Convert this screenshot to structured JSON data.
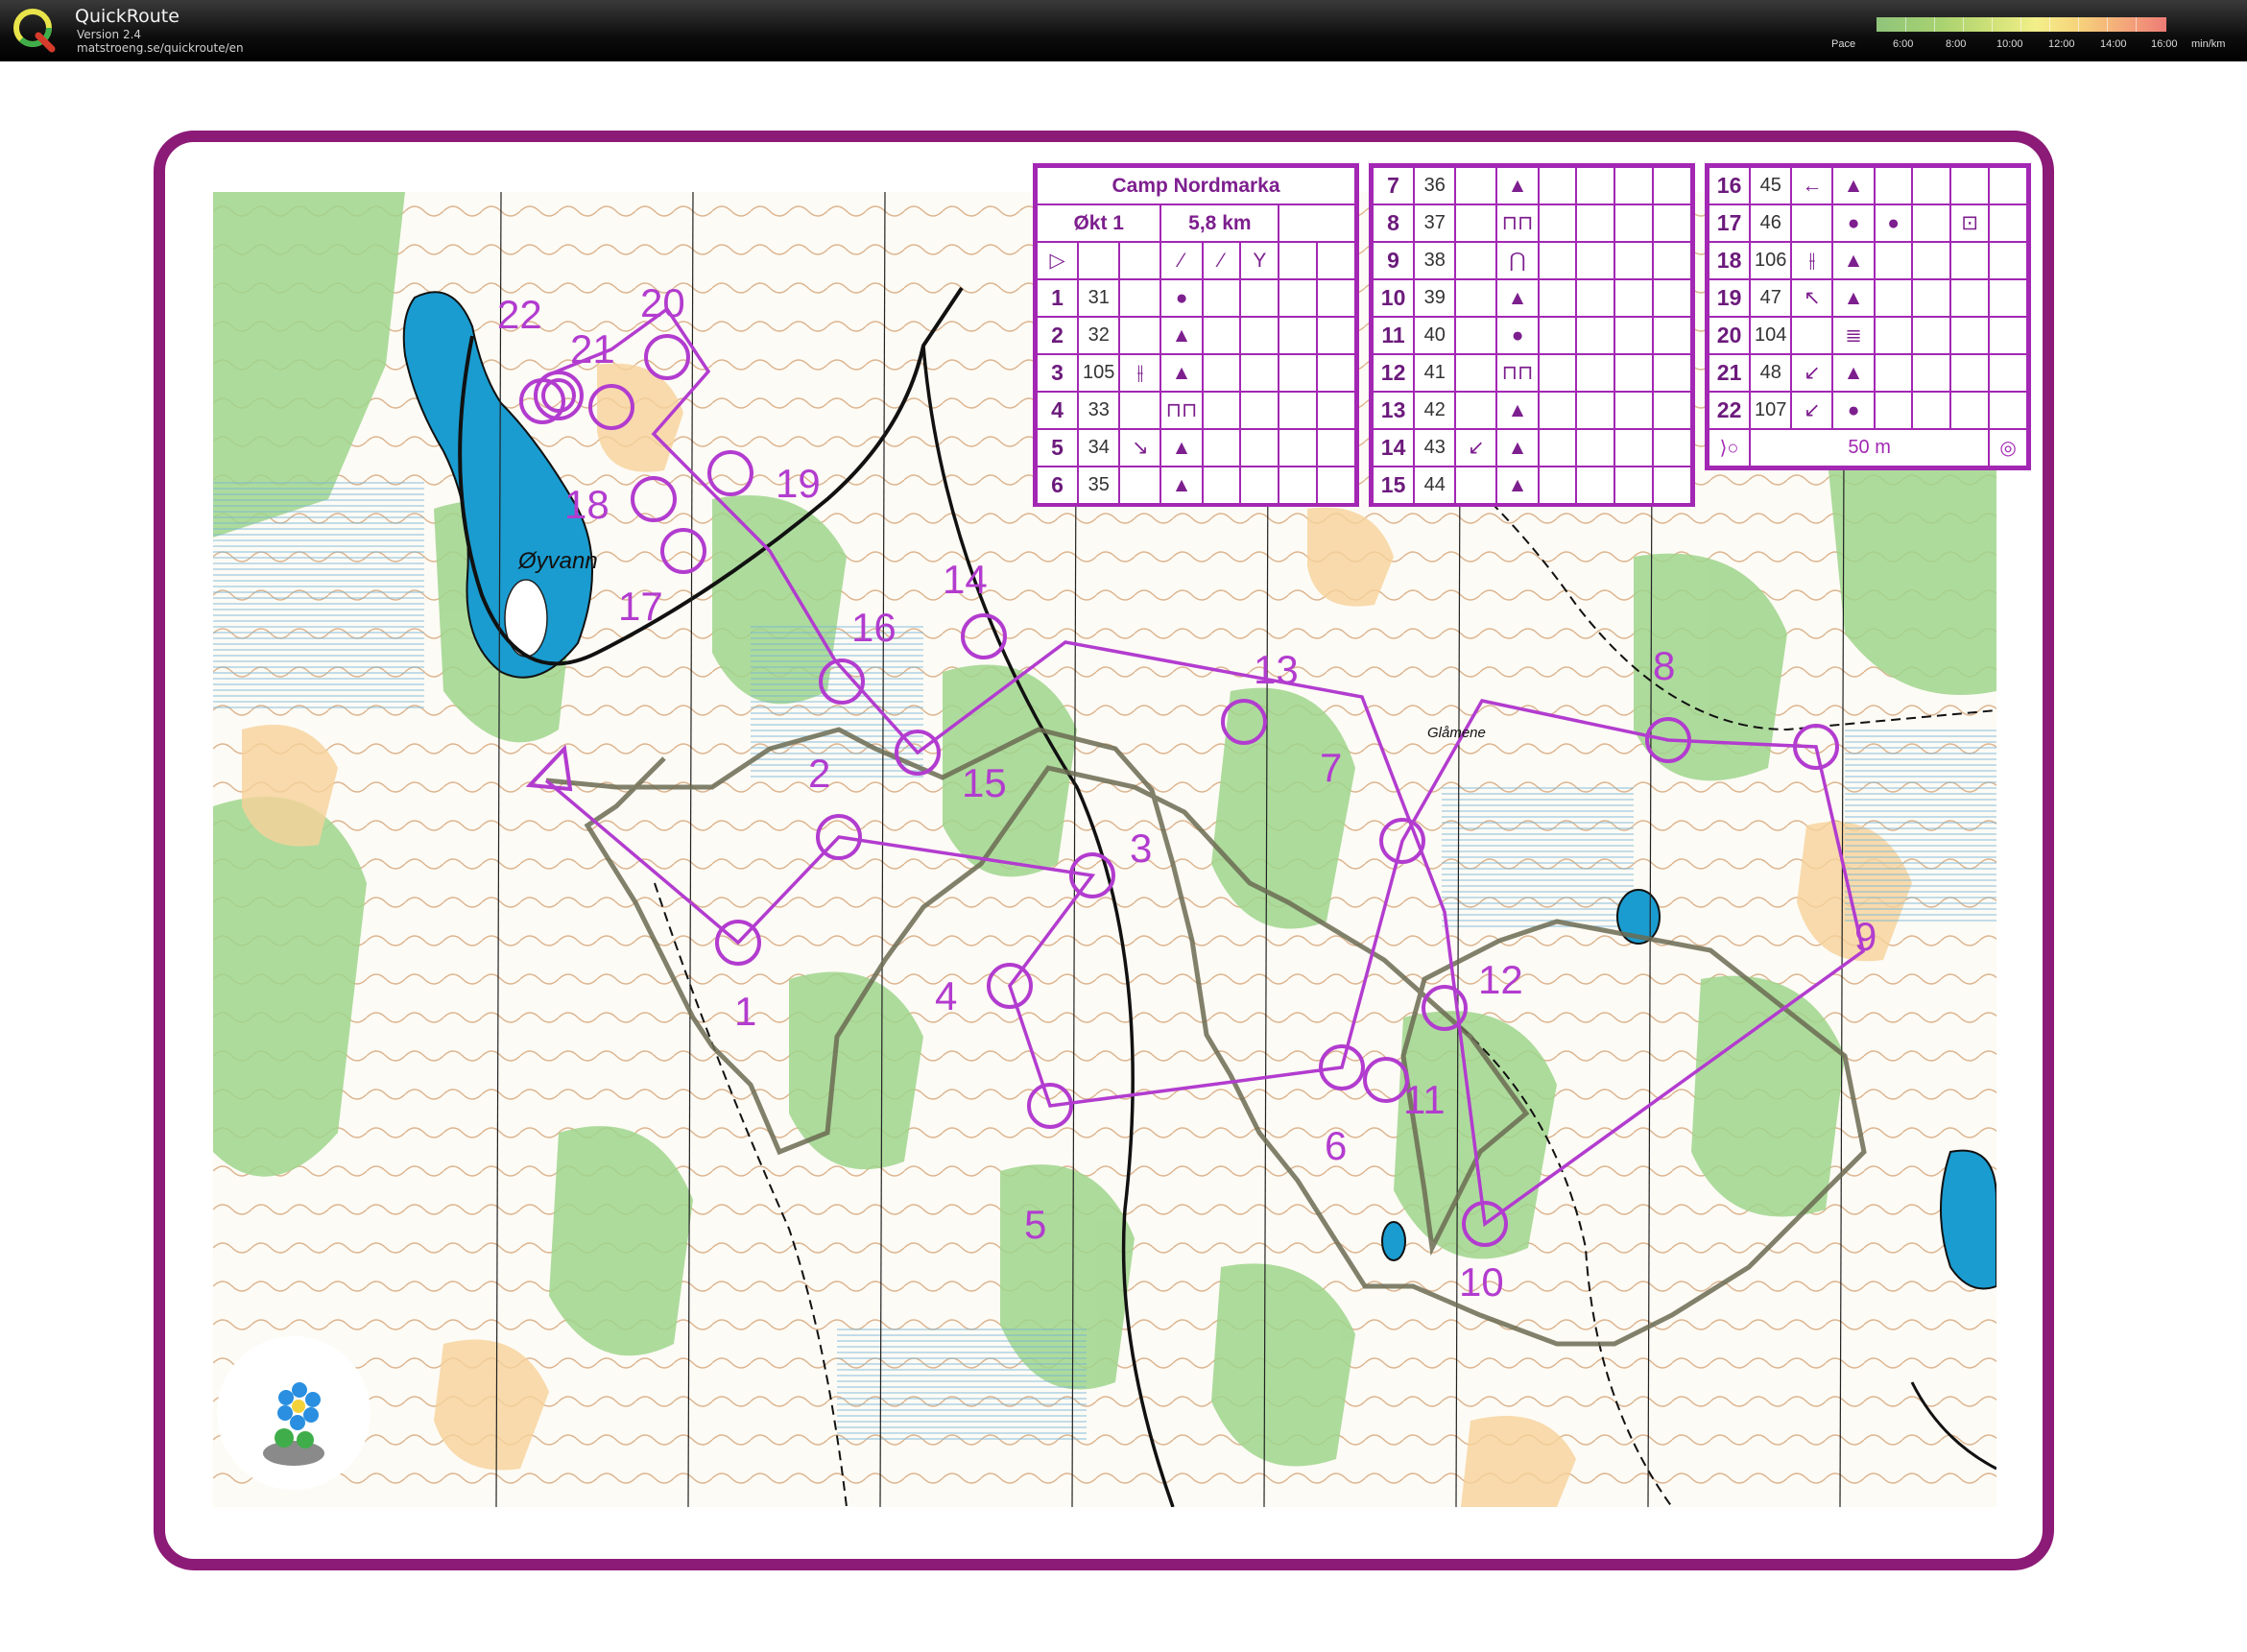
{
  "app": {
    "title": "QuickRoute",
    "version": "Version 2.4",
    "url": "matstroeng.se/quickroute/en",
    "logo_icon": "quickroute-q-logo"
  },
  "pace_scale": {
    "label": "Pace",
    "ticks": [
      "6:00",
      "8:00",
      "10:00",
      "12:00",
      "14:00",
      "16:00"
    ],
    "unit": "min/km",
    "colors": [
      "#8fc47a",
      "#cfe178",
      "#f3ef8a",
      "#f4a97a",
      "#ee7c76"
    ]
  },
  "map": {
    "frame_color": "#8c1a77",
    "course_color": "#b23ccf",
    "route_color": "#6b6b52",
    "lake_color": "#1a9cd0",
    "place_labels": {
      "lake": "Øyvann",
      "area": "Glåmene"
    },
    "controls": [
      "1",
      "2",
      "3",
      "4",
      "5",
      "6",
      "7",
      "8",
      "9",
      "10",
      "11",
      "12",
      "13",
      "14",
      "15",
      "16",
      "17",
      "18",
      "19",
      "20",
      "21",
      "22"
    ],
    "start_icon": "start-triangle-icon",
    "finish_icon": "finish-double-circle-icon"
  },
  "description": {
    "event": "Camp Nordmarka",
    "class": "Økt 1",
    "length": "5,8 km",
    "start_symbols": [
      "▷",
      "",
      "⁄",
      "⁄",
      "Y"
    ],
    "rows_col1": [
      {
        "n": "1",
        "code": "31",
        "dir": "",
        "feat": "●"
      },
      {
        "n": "2",
        "code": "32",
        "dir": "",
        "feat": "▲"
      },
      {
        "n": "3",
        "code": "105",
        "dir": "⫲",
        "feat": "▲"
      },
      {
        "n": "4",
        "code": "33",
        "dir": "",
        "feat": "⊓⊓"
      },
      {
        "n": "5",
        "code": "34",
        "dir": "↘",
        "feat": "▲"
      },
      {
        "n": "6",
        "code": "35",
        "dir": "",
        "feat": "▲"
      }
    ],
    "rows_col2": [
      {
        "n": "7",
        "code": "36",
        "dir": "",
        "feat": "▲"
      },
      {
        "n": "8",
        "code": "37",
        "dir": "",
        "feat": "⊓⊓"
      },
      {
        "n": "9",
        "code": "38",
        "dir": "",
        "feat": "⋂"
      },
      {
        "n": "10",
        "code": "39",
        "dir": "",
        "feat": "▲"
      },
      {
        "n": "11",
        "code": "40",
        "dir": "",
        "feat": "●"
      },
      {
        "n": "12",
        "code": "41",
        "dir": "",
        "feat": "⊓⊓"
      },
      {
        "n": "13",
        "code": "42",
        "dir": "",
        "feat": "▲"
      },
      {
        "n": "14",
        "code": "43",
        "dir": "↙",
        "feat": "▲"
      },
      {
        "n": "15",
        "code": "44",
        "dir": "",
        "feat": "▲"
      }
    ],
    "rows_col3": [
      {
        "n": "16",
        "code": "45",
        "dir": "←",
        "feat": "▲",
        "extra": ""
      },
      {
        "n": "17",
        "code": "46",
        "dir": "",
        "feat": "●",
        "extra": "●"
      },
      {
        "n": "18",
        "code": "106",
        "dir": "⫲",
        "feat": "▲",
        "extra": ""
      },
      {
        "n": "19",
        "code": "47",
        "dir": "↖",
        "feat": "▲",
        "extra": ""
      },
      {
        "n": "20",
        "code": "104",
        "dir": "",
        "feat": "≣",
        "extra": ""
      },
      {
        "n": "21",
        "code": "48",
        "dir": "↙",
        "feat": "▲",
        "extra": ""
      },
      {
        "n": "22",
        "code": "107",
        "dir": "↙",
        "feat": "●",
        "extra": ""
      }
    ],
    "finish_distance": "50 m"
  }
}
